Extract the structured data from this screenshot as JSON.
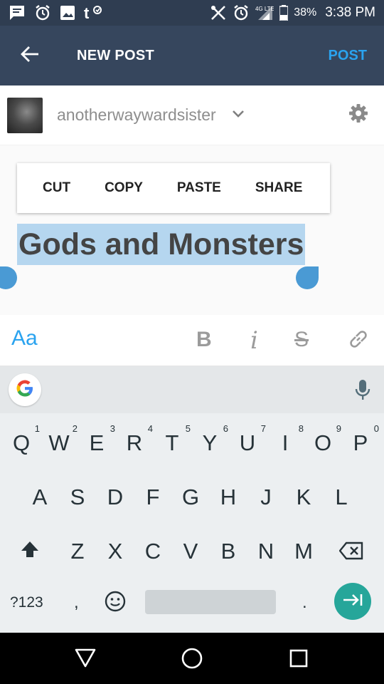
{
  "status_bar": {
    "battery": "38%",
    "time": "3:38 PM",
    "network": "4G LTE",
    "icons": [
      "message-icon",
      "alarm-icon",
      "image-icon",
      "tumblr-icon",
      "tools-icon",
      "alarm-icon",
      "signal-icon",
      "battery-icon"
    ]
  },
  "app_bar": {
    "title": "NEW POST",
    "post_label": "POST",
    "accent": "#2aa3ef",
    "bg": "#36465d"
  },
  "account": {
    "blog_name": "anotherwaywardsister"
  },
  "context_menu": {
    "cut": "CUT",
    "copy": "COPY",
    "paste": "PASTE",
    "share": "SHARE"
  },
  "editor": {
    "selected_text": "Gods and Monsters",
    "selection_color": "#b5d6ef"
  },
  "format_toolbar": {
    "text_style": "Aa",
    "bold": "B",
    "italic": "i",
    "strike": "S"
  },
  "keyboard": {
    "row1": [
      "Q",
      "W",
      "E",
      "R",
      "T",
      "Y",
      "U",
      "I",
      "O",
      "P"
    ],
    "row1_hints": [
      "1",
      "2",
      "3",
      "4",
      "5",
      "6",
      "7",
      "8",
      "9",
      "0"
    ],
    "row2": [
      "A",
      "S",
      "D",
      "F",
      "G",
      "H",
      "J",
      "K",
      "L"
    ],
    "row3": [
      "Z",
      "X",
      "C",
      "V",
      "B",
      "N",
      "M"
    ],
    "symbols": "?123",
    "comma": ",",
    "period": "."
  }
}
